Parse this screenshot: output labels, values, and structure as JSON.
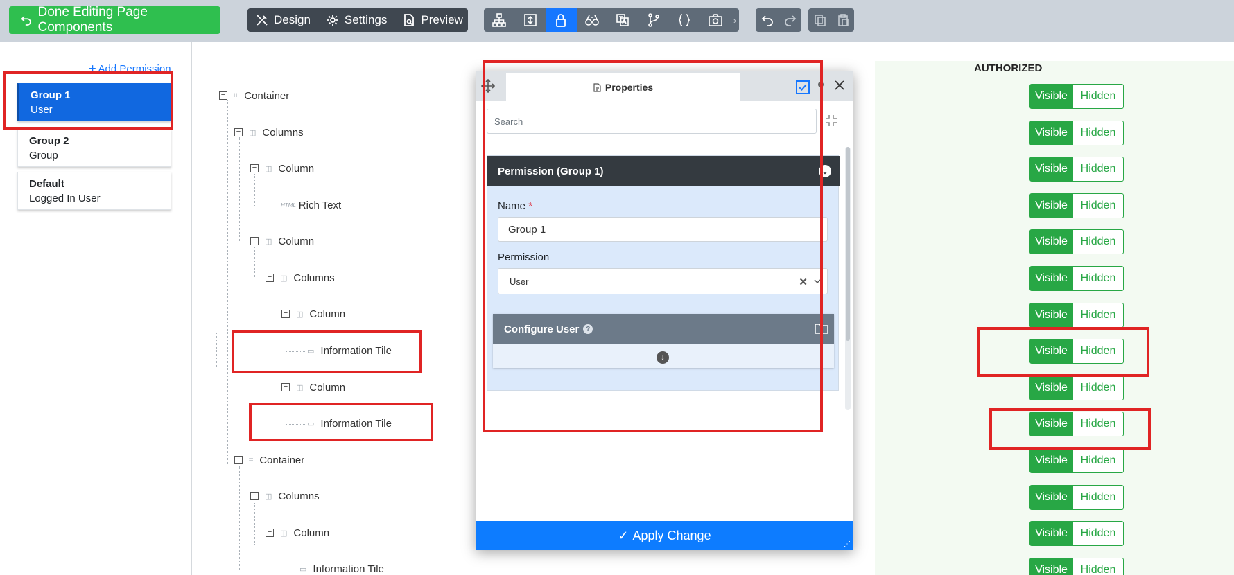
{
  "toolbar": {
    "done_label": "Done Editing Page Components",
    "design_label": "Design",
    "settings_label": "Settings",
    "preview_label": "Preview",
    "tools": [
      "hierarchy-icon",
      "layout-icon",
      "lock-icon",
      "binoculars-icon",
      "translate-icon",
      "branch-icon",
      "code-braces-icon",
      "camera-icon"
    ],
    "active_tool": "lock-icon",
    "more_glyph": "›"
  },
  "permissions": {
    "add_label": "Add Permission",
    "items": [
      {
        "title": "Group 1",
        "subtitle": "User",
        "selected": true
      },
      {
        "title": "Group 2",
        "subtitle": "Group",
        "selected": false
      },
      {
        "title": "Default",
        "subtitle": "Logged In User",
        "selected": false
      }
    ]
  },
  "tree": {
    "nodes": [
      {
        "label": "Container",
        "toggle": "−",
        "icon": "⌗"
      },
      {
        "label": "Columns",
        "toggle": "−",
        "icon": "◫"
      },
      {
        "label": "Column",
        "toggle": "−",
        "icon": "◫"
      },
      {
        "label": "Rich Text",
        "icon": "HTML"
      },
      {
        "label": "Column",
        "toggle": "−",
        "icon": "◫"
      },
      {
        "label": "Columns",
        "toggle": "−",
        "icon": "◫"
      },
      {
        "label": "Column",
        "toggle": "−",
        "icon": "◫"
      },
      {
        "label": "Information Tile",
        "icon": "▭"
      },
      {
        "label": "Column",
        "toggle": "−",
        "icon": "◫"
      },
      {
        "label": "Information Tile",
        "icon": "▭"
      },
      {
        "label": "Container",
        "toggle": "−",
        "icon": "⌗"
      },
      {
        "label": "Columns",
        "toggle": "−",
        "icon": "◫"
      },
      {
        "label": "Column",
        "toggle": "−",
        "icon": "◫"
      },
      {
        "label": "Information Tile",
        "icon": "▭"
      }
    ]
  },
  "modal": {
    "tab_label": "Properties",
    "search_placeholder": "Search",
    "section_title": "Permission (Group 1)",
    "name_label": "Name",
    "name_required": "*",
    "name_value": "Group 1",
    "permission_label": "Permission",
    "permission_value": "User",
    "clear_glyph": "✕",
    "configure_label": "Configure User",
    "help_glyph": "?",
    "apply_label": "Apply Change",
    "apply_glyph": "✓"
  },
  "authorized": {
    "title": "AUTHORIZED",
    "visible_label": "Visible",
    "hidden_label": "Hidden",
    "rows": 14
  },
  "colors": {
    "accent_blue": "#1677ff",
    "success_green": "#28a745",
    "toolbar_dark": "#3f4750",
    "highlight_red": "#e02424"
  }
}
